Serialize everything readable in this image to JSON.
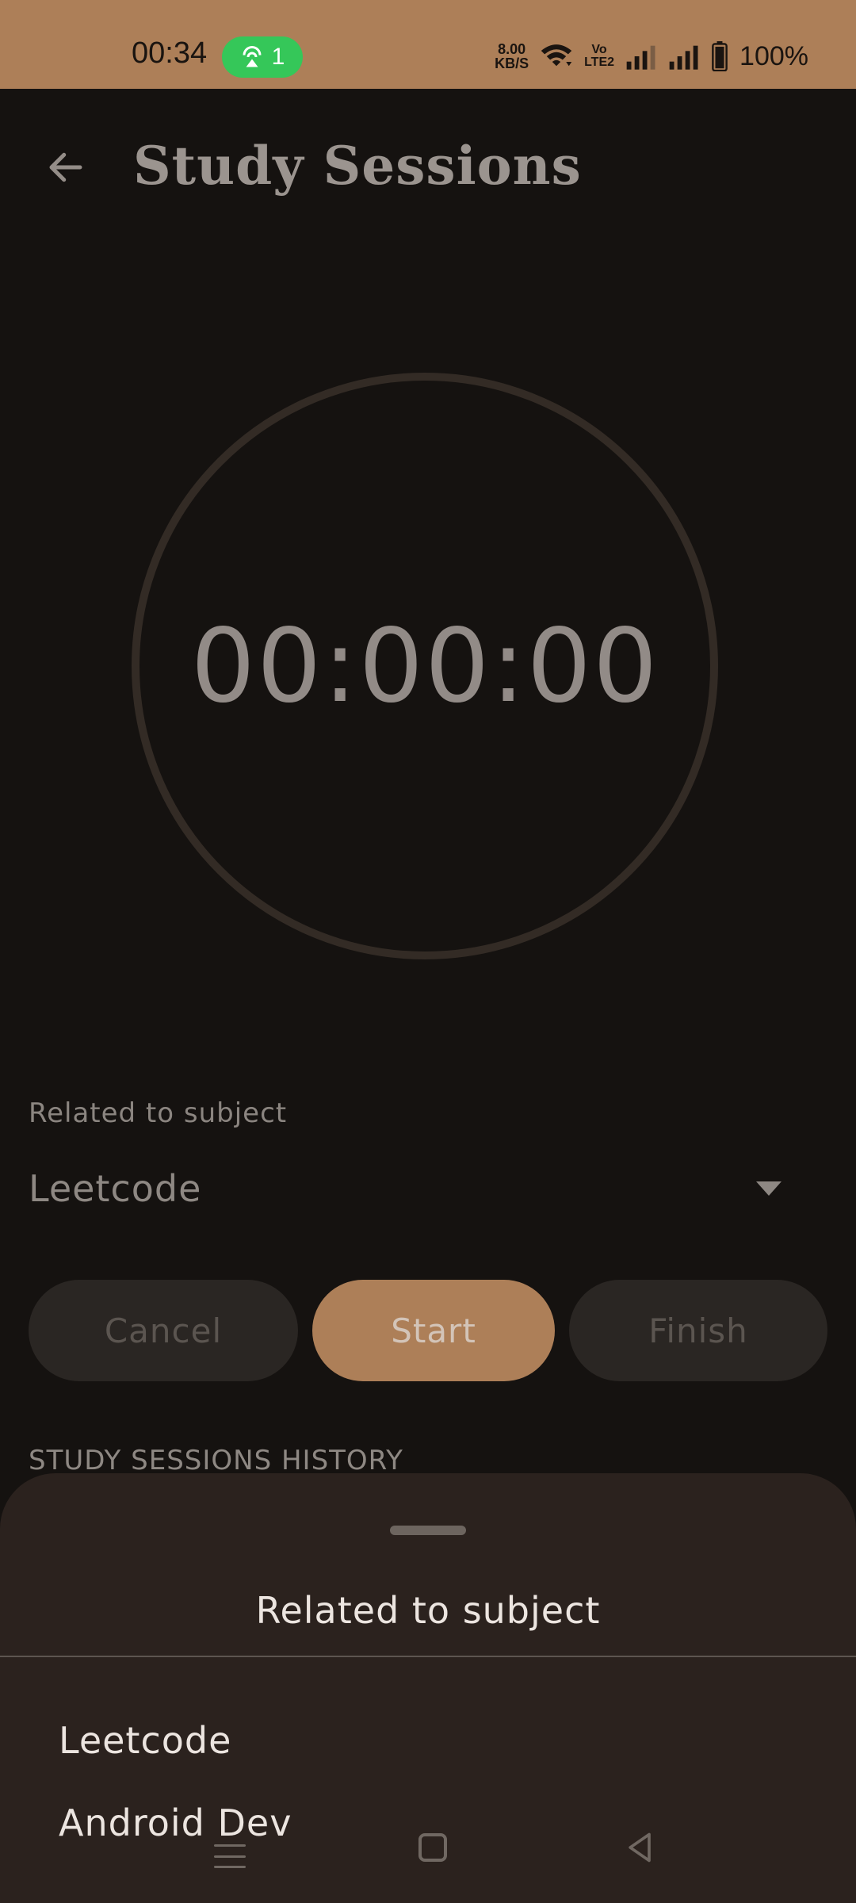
{
  "status_bar": {
    "time": "00:34",
    "hotspot_count": "1",
    "net_speed_value": "8.00",
    "net_speed_unit": "KB/S",
    "volte_line1": "Vo",
    "volte_line2": "LTE2",
    "battery": "100%",
    "icons": [
      "hotspot-icon",
      "wifi-icon",
      "signal-icon",
      "signal-icon",
      "battery-icon"
    ],
    "background_color": "#ad7f58"
  },
  "header": {
    "title": "Study Sessions"
  },
  "timer": {
    "display": "00:00:00"
  },
  "subject": {
    "label": "Related to subject",
    "selected": "Leetcode"
  },
  "buttons": {
    "cancel": "Cancel",
    "start": "Start",
    "finish": "Finish"
  },
  "history": {
    "label": "STUDY SESSIONS HISTORY"
  },
  "sheet": {
    "title": "Related to subject",
    "options": [
      "Leetcode",
      "Android Dev"
    ]
  },
  "colors": {
    "accent": "#ad7f58",
    "background": "#151210",
    "sheet": "#2b221e"
  }
}
